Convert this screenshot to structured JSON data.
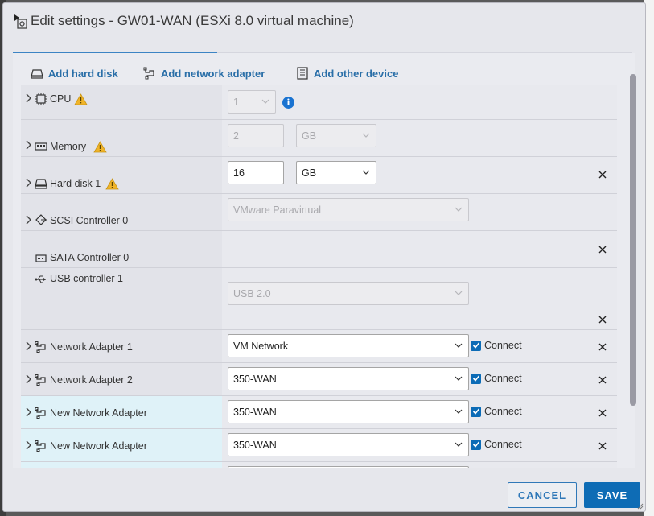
{
  "dialog": {
    "title": "Edit settings - GW01-WAN (ESXi 8.0 virtual machine)"
  },
  "add_bar": {
    "add_hard_disk": "Add hard disk",
    "add_network_adapter": "Add network adapter",
    "add_other_device": "Add other device"
  },
  "rows": {
    "cpu": {
      "label": "CPU",
      "value": "1"
    },
    "memory": {
      "label": "Memory",
      "value": "2",
      "unit": "GB"
    },
    "hard_disk": {
      "label": "Hard disk 1",
      "value": "16",
      "unit": "GB"
    },
    "scsi": {
      "label": "SCSI Controller 0",
      "value": "VMware Paravirtual"
    },
    "sata": {
      "label": "SATA Controller 0"
    },
    "usb": {
      "label": "USB controller 1",
      "value": "USB 2.0"
    },
    "net1": {
      "label": "Network Adapter 1",
      "value": "VM Network",
      "connect": "Connect"
    },
    "net2": {
      "label": "Network Adapter 2",
      "value": "350-WAN",
      "connect": "Connect"
    },
    "net3": {
      "label": "New Network Adapter",
      "value": "350-WAN",
      "connect": "Connect"
    },
    "net4": {
      "label": "New Network Adapter",
      "value": "350-WAN",
      "connect": "Connect"
    }
  },
  "footer": {
    "cancel": "CANCEL",
    "save": "SAVE"
  },
  "colors": {
    "accent": "#0e6cb5",
    "link": "#2a6fa8",
    "warning": "#f0b429",
    "new_row": "#dff2f8"
  },
  "icons": [
    "vm-settings-icon",
    "hard-disk-icon",
    "network-adapter-icon",
    "device-icon",
    "cpu-icon",
    "memory-icon",
    "warning-icon",
    "scsi-icon",
    "sata-icon",
    "usb-icon",
    "info-icon",
    "close-icon",
    "chevron-right-icon",
    "chevron-down-icon"
  ]
}
